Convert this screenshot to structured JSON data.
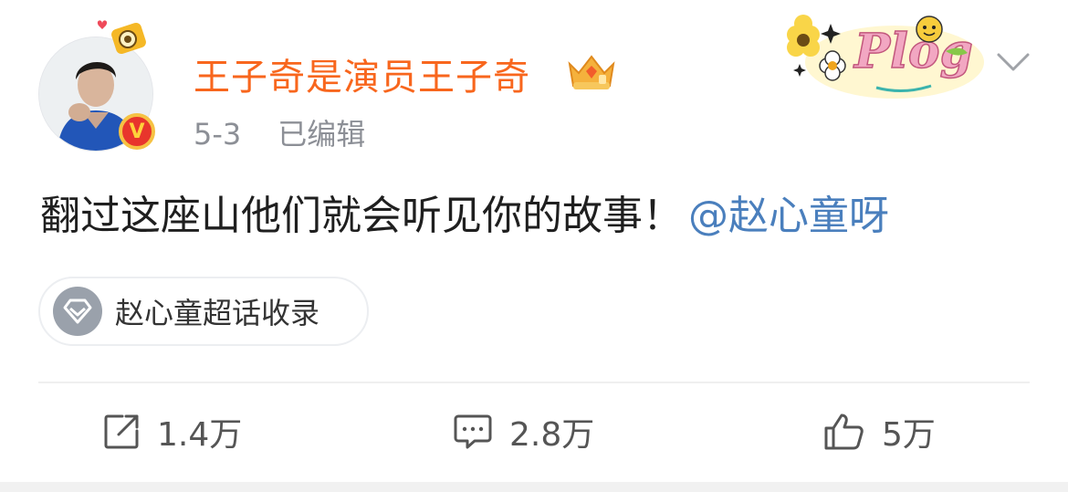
{
  "post": {
    "author": {
      "name": "王子奇是演员王子奇",
      "verified_badge": "V"
    },
    "date": "5-3",
    "edited_label": "已编辑",
    "decoration_text": "Plog",
    "text": "翻过这座山他们就会听见你的故事！",
    "mention": "@赵心童呀",
    "topic_tag": "赵心童超话收录",
    "actions": {
      "repost_count": "1.4万",
      "comment_count": "2.8万",
      "like_count": "5万"
    }
  },
  "colors": {
    "username": "#f8661d",
    "mention": "#4a7fbd",
    "meta": "#8c8f96",
    "text": "#1f1f1f"
  },
  "icons": [
    "v-badge-icon",
    "pendant-icon",
    "crown-badge-icon",
    "plog-sticker",
    "chevron-down-icon",
    "diamond-icon",
    "share-icon",
    "comment-icon",
    "thumbs-up-icon"
  ]
}
